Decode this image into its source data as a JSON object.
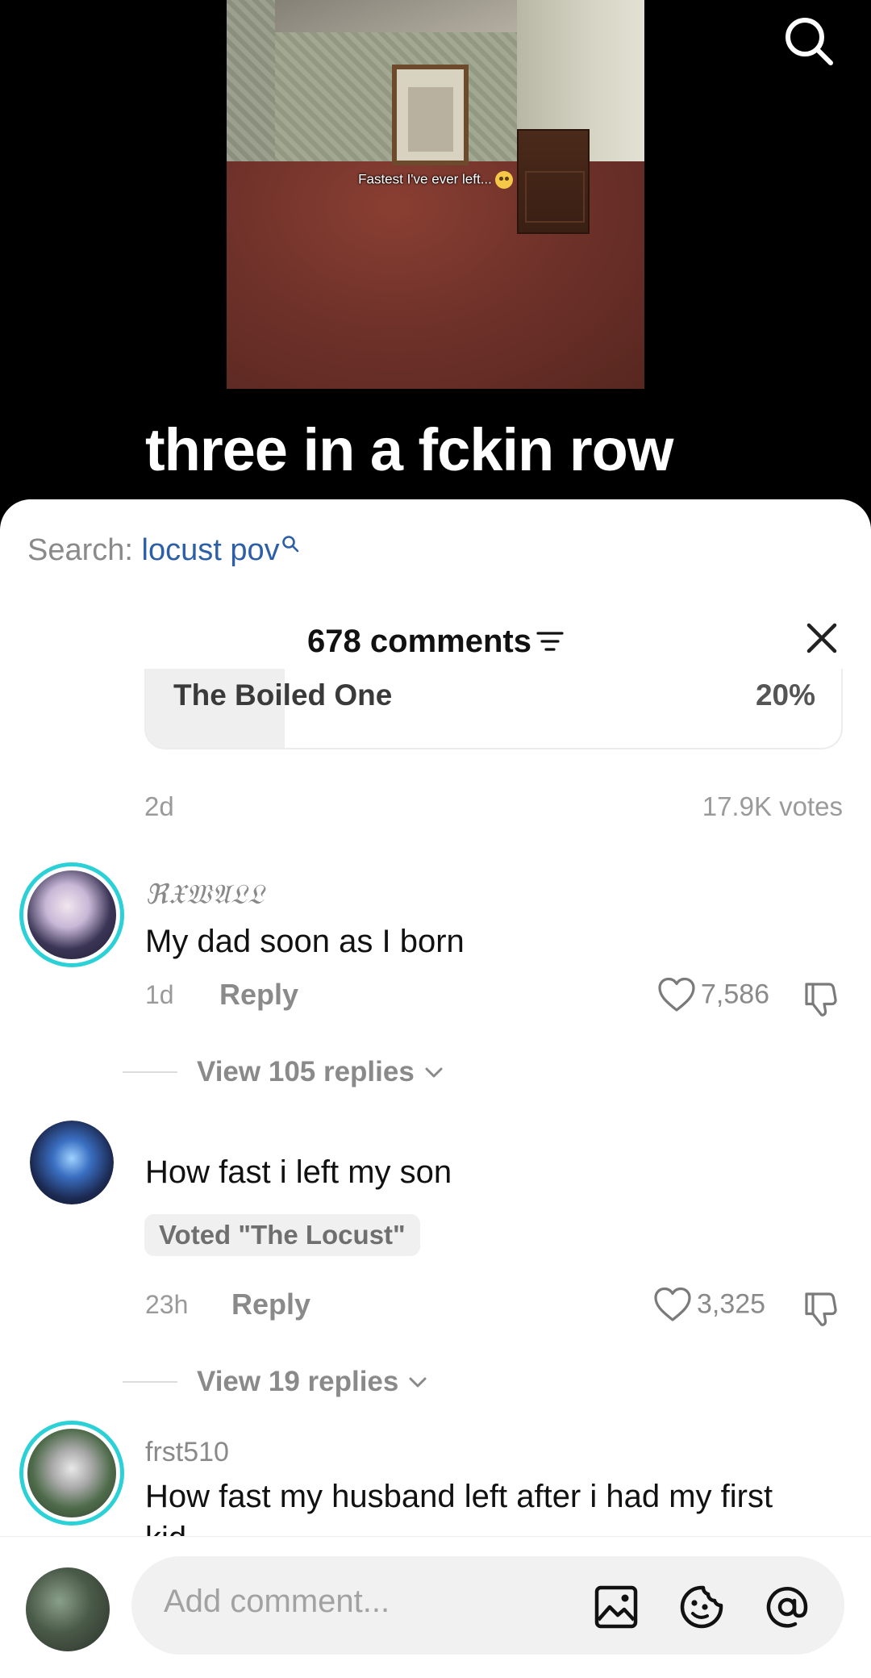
{
  "video": {
    "caption_text": "Fastest I've ever left...",
    "title": "three in a fckin row"
  },
  "sheet": {
    "search_label": "Search:",
    "search_term": "locust pov",
    "comment_count": "678 comments"
  },
  "poll": {
    "option_label": "The Boiled One",
    "option_percent": "20%",
    "option_fill_fraction": 0.2,
    "age": "2d",
    "votes": "17.9K votes"
  },
  "comments": [
    {
      "username": "ℜ𝔛𝔚𝔄𝔏𝔏",
      "text": "My dad soon as I born",
      "time": "1d",
      "reply_label": "Reply",
      "likes": "7,586",
      "view_replies": "View 105 replies"
    },
    {
      "text": "How fast i left my son",
      "vote_badge": "Voted \"The Locust\"",
      "time": "23h",
      "reply_label": "Reply",
      "likes": "3,325",
      "view_replies": "View 19 replies"
    },
    {
      "username": "frst510",
      "text": "How fast my husband left after i had my first kid"
    }
  ],
  "composer": {
    "placeholder": "Add comment..."
  },
  "colors": {
    "link_blue": "#2d5fa6",
    "story_ring": "#2bd1d6",
    "muted_text": "#8a8a8a"
  },
  "icons": [
    "search-icon",
    "filter-icon",
    "close-icon",
    "heart-icon",
    "dislike-icon",
    "chevron-down-icon",
    "image-icon",
    "emoji-icon",
    "mention-icon"
  ]
}
